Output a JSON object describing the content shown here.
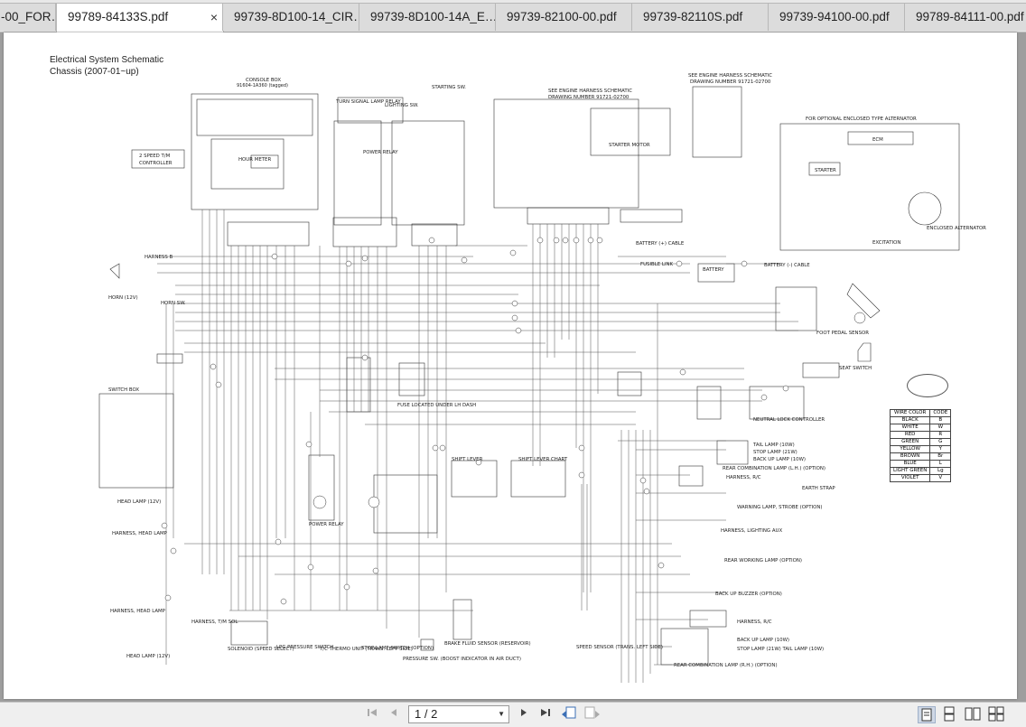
{
  "tabs": [
    {
      "label": "-00_FOR…",
      "active": false
    },
    {
      "label": "99789-84133S.pdf",
      "active": true
    },
    {
      "label": "99739-8D100-14_CIR…",
      "active": false
    },
    {
      "label": "99739-8D100-14A_E…",
      "active": false
    },
    {
      "label": "99739-82100-00.pdf",
      "active": false
    },
    {
      "label": "99739-82110S.pdf",
      "active": false
    },
    {
      "label": "99739-94100-00.pdf",
      "active": false
    },
    {
      "label": "99789-84111-00.pdf",
      "active": false
    }
  ],
  "close_glyph": "×",
  "document": {
    "title_line1": "Electrical System Schematic",
    "title_line2": "Chassis (2007-01~up)",
    "labels": {
      "console_box": "CONSOLE BOX",
      "console_box_pn": "91604-1A360 (tagged)",
      "hour_meter": "HOUR METER",
      "speed_tm": "2 SPEED T/M",
      "controller": "CONTROLLER",
      "harness_b": "HARNESS B",
      "horn": "HORN (12V)",
      "horn_sw": "HORN SW.",
      "switch_box": "SWITCH BOX",
      "head_lamp": "HEAD LAMP (12V)",
      "harness_head_lamp": "HARNESS, HEAD LAMP",
      "head_lamp_bottom": "HEAD LAMP (12V)",
      "turn_signal": "TURN SIGNAL LAMP RELAY",
      "lighting_sw": "LIGHTING SW.",
      "starting_sw": "STARTING SW.",
      "power_relay": "POWER RELAY",
      "see_engine_1": "SEE ENGINE HARNESS SCHEMATIC",
      "drawing_1": "DRAWING NUMBER 91721-02700",
      "starter_motor": "STARTER MOTOR",
      "see_engine_2": "SEE ENGINE HARNESS SCHEMATIC",
      "drawing_2": "DRAWING NUMBER 91721-02700",
      "optional_alt": "FOR OPTIONAL ENCLOSED TYPE ALTERNATOR",
      "ecm": "ECM",
      "starter": "STARTER",
      "enclosed_alt": "ENCLOSED ALTERNATOR",
      "excitation": "EXCITATION",
      "battery_cable_pos": "BATTERY (+) CABLE",
      "fusible_link": "FUSIBLE LINK",
      "battery": "BATTERY",
      "battery_cable_neg": "BATTERY (-) CABLE",
      "foot_pedal": "FOOT PEDAL SENSOR",
      "seat_switch": "SEAT SWITCH",
      "neutral_lock": "NEUTRAL LOCK CONTROLLER",
      "shift_lever": "SHIFT LEVER",
      "shift_chart": "SHIFT LEVER CHART",
      "tail_lamp": "TAIL LAMP (10W)",
      "stop_lamp": "STOP LAMP (21W)",
      "back_up_lamp": "BACK UP LAMP (10W)",
      "rear_combo": "REAR COMBINATION LAMP (L.H.) (OPTION)",
      "harness_rc": "HARNESS, R/C",
      "earth_strap": "EARTH STRAP",
      "warning_lamp": "WARNING LAMP, STROBE (OPTION)",
      "harness_lighting": "HARNESS, LIGHTING AUX",
      "rear_working": "REAR WORKING LAMP (OPTION)",
      "back_up_buzzer": "BACK UP BUZZER (OPTION)",
      "harness_rc_2": "HARNESS, R/C",
      "back_up_lamp_2": "BACK UP LAMP (10W)",
      "stop_tail": "STOP LAMP (21W) TAIL LAMP (10W)",
      "rear_combo_rh": "REAR COMBINATION LAMP (R.H.) (OPTION)",
      "speed_sensor": "SPEED SENSOR (TRANS. LEFT SIDE)",
      "brake_fluid": "BRAKE FLUID SENSOR (RESERVOIR)",
      "pressure_sw": "PRESSURE SW. (BOOST INDICATOR IN AIR DUCT)",
      "stop_lamp_sw": "STOP LAMP SWITCH (OPTION)",
      "thermo_unit": "T/C THERMO UNIT (TRANS. LEFT SIDE)",
      "lpg_switch": "LPG PRESSURE SWITCH",
      "solenoid": "SOLENOID (SPEED SELECT)",
      "harness_tm": "HARNESS, T/M SOL",
      "power_relay_2": "POWER RELAY",
      "fuse_located": "FUSE LOCATED UNDER LH DASH"
    },
    "wire_color_table": {
      "header": [
        "WIRE COLOR",
        "CODE"
      ],
      "rows": [
        [
          "BLACK",
          "B"
        ],
        [
          "WHITE",
          "W"
        ],
        [
          "RED",
          "R"
        ],
        [
          "GREEN",
          "G"
        ],
        [
          "YELLOW",
          "Y"
        ],
        [
          "BROWN",
          "Br"
        ],
        [
          "BLUE",
          "L"
        ],
        [
          "LIGHT GREEN",
          "Lg"
        ],
        [
          "VIOLET",
          "V"
        ]
      ]
    }
  },
  "toolbar": {
    "page_indicator": "1 / 2",
    "icons": [
      "first-page-icon",
      "prev-page-icon",
      "next-page-icon",
      "last-page-icon",
      "previous-view-icon",
      "next-view-icon",
      "single-page-view-icon",
      "continuous-view-icon",
      "facing-view-icon",
      "continuous-facing-view-icon"
    ]
  }
}
